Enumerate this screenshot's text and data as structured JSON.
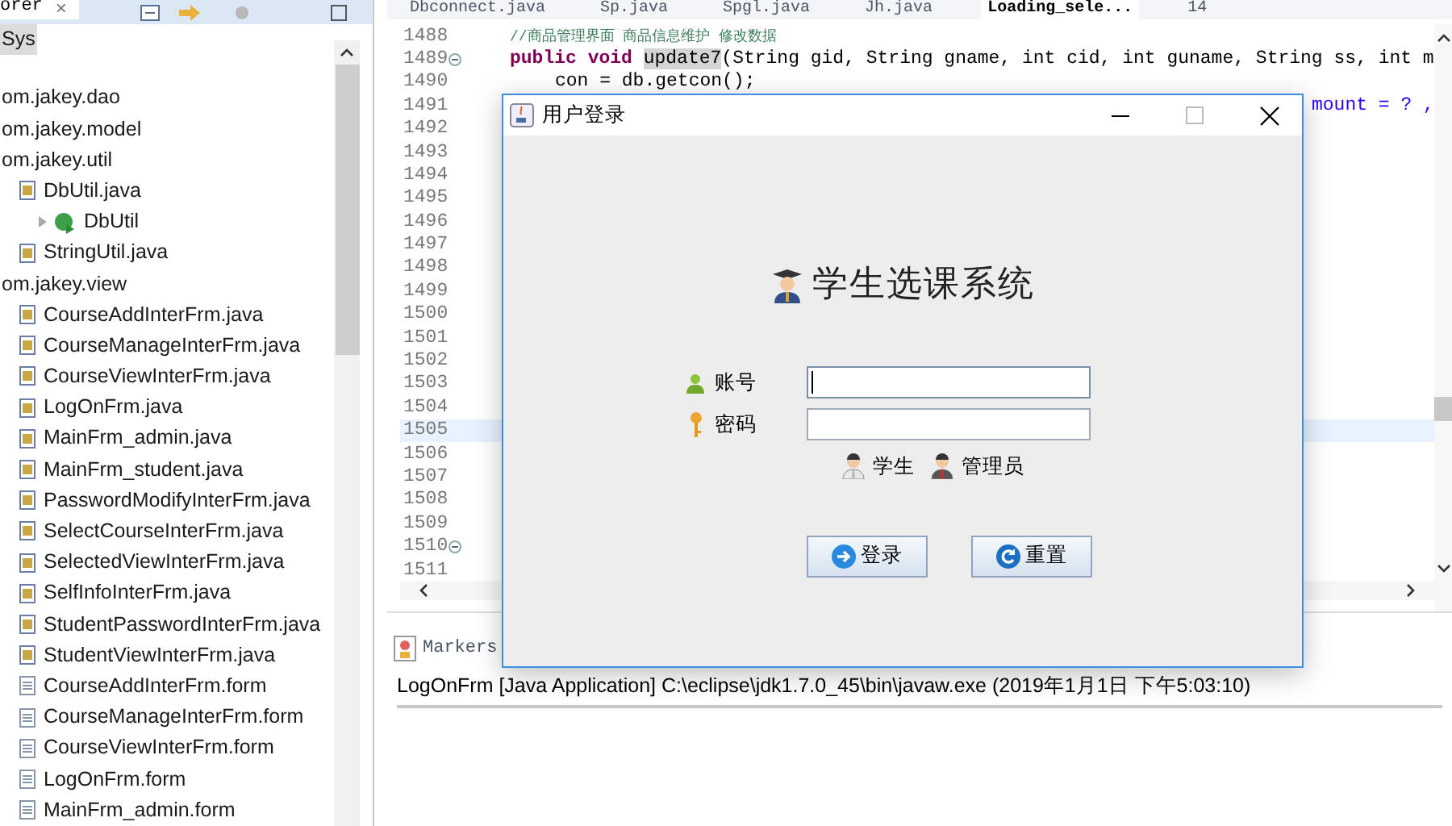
{
  "explorer": {
    "tab": {
      "title": "orer",
      "close": "×"
    },
    "tree": [
      {
        "label": "Sys",
        "kind": "project",
        "selected": true
      },
      {
        "label": "om.jakey.dao",
        "kind": "package",
        "selected": false
      },
      {
        "label": "om.jakey.model",
        "kind": "package",
        "selected": false
      },
      {
        "label": "om.jakey.util",
        "kind": "package",
        "selected": false,
        "children": [
          {
            "label": "DbUtil.java",
            "kind": "java",
            "selected": false,
            "children": [
              {
                "label": "DbUtil",
                "kind": "class",
                "selected": false
              }
            ]
          },
          {
            "label": "StringUtil.java",
            "kind": "java",
            "selected": false
          }
        ]
      },
      {
        "label": "om.jakey.view",
        "kind": "package",
        "selected": false,
        "children": [
          {
            "label": "CourseAddInterFrm.java",
            "kind": "java",
            "selected": false
          },
          {
            "label": "CourseManageInterFrm.java",
            "kind": "java",
            "selected": false
          },
          {
            "label": "CourseViewInterFrm.java",
            "kind": "java",
            "selected": false
          },
          {
            "label": "LogOnFrm.java",
            "kind": "java",
            "selected": false
          },
          {
            "label": "MainFrm_admin.java",
            "kind": "java",
            "selected": false
          },
          {
            "label": "MainFrm_student.java",
            "kind": "java",
            "selected": false
          },
          {
            "label": "PasswordModifyInterFrm.java",
            "kind": "java",
            "selected": false
          },
          {
            "label": "SelectCourseInterFrm.java",
            "kind": "java",
            "selected": false
          },
          {
            "label": "SelectedViewInterFrm.java",
            "kind": "java",
            "selected": false
          },
          {
            "label": "SelfInfoInterFrm.java",
            "kind": "java",
            "selected": false
          },
          {
            "label": "StudentPasswordInterFrm.java",
            "kind": "java",
            "selected": false
          },
          {
            "label": "StudentViewInterFrm.java",
            "kind": "java",
            "selected": false
          },
          {
            "label": "CourseAddInterFrm.form",
            "kind": "form",
            "selected": false
          },
          {
            "label": "CourseManageInterFrm.form",
            "kind": "form",
            "selected": false
          },
          {
            "label": "CourseViewInterFrm.form",
            "kind": "form",
            "selected": false
          },
          {
            "label": "LogOnFrm.form",
            "kind": "form",
            "selected": false
          },
          {
            "label": "MainFrm_admin.form",
            "kind": "form",
            "selected": false
          }
        ]
      }
    ]
  },
  "editor": {
    "tabs": [
      {
        "label": "Dbconnect.java",
        "selected": false
      },
      {
        "label": "Sp.java",
        "selected": false
      },
      {
        "label": "Spgl.java",
        "selected": false
      },
      {
        "label": "Jh.java",
        "selected": false
      },
      {
        "label": "Loading_sele...",
        "selected": true
      },
      {
        "label": "14",
        "selected": false
      }
    ],
    "lines": [
      {
        "number": "1488",
        "kind": "comment",
        "text": "//商品管理界面 商品信息维护 修改数据",
        "fold": false,
        "current": false
      },
      {
        "number": "1489",
        "kind": "signature",
        "text": "update7(String gid, String gname, int cid, int guname, String ss, int m",
        "fold": true,
        "current": false
      },
      {
        "number": "1490",
        "kind": "plain",
        "text": "con = db.getcon();",
        "fold": false,
        "current": false
      },
      {
        "number": "1491",
        "kind": "tail",
        "text": "mount = ? ,",
        "fold": false,
        "current": false
      },
      {
        "number": "1492",
        "kind": "plain",
        "fold": false,
        "current": false
      },
      {
        "number": "1493",
        "kind": "plain",
        "fold": false,
        "current": false
      },
      {
        "number": "1494",
        "kind": "plain",
        "fold": false,
        "current": false
      },
      {
        "number": "1495",
        "kind": "plain",
        "fold": false,
        "current": false
      },
      {
        "number": "1496",
        "kind": "plain",
        "fold": false,
        "current": false
      },
      {
        "number": "1497",
        "kind": "plain",
        "fold": false,
        "current": false
      },
      {
        "number": "1498",
        "kind": "plain",
        "fold": false,
        "current": false
      },
      {
        "number": "1499",
        "kind": "plain",
        "fold": false,
        "current": false
      },
      {
        "number": "1500",
        "kind": "plain",
        "fold": false,
        "current": false
      },
      {
        "number": "1501",
        "kind": "plain",
        "fold": false,
        "current": false
      },
      {
        "number": "1502",
        "kind": "plain",
        "fold": false,
        "current": false
      },
      {
        "number": "1503",
        "kind": "plain",
        "fold": false,
        "current": false
      },
      {
        "number": "1504",
        "kind": "plain",
        "fold": false,
        "current": false
      },
      {
        "number": "1505",
        "kind": "plain",
        "fold": false,
        "current": true
      },
      {
        "number": "1506",
        "kind": "plain",
        "fold": false,
        "current": false
      },
      {
        "number": "1507",
        "kind": "plain",
        "fold": false,
        "current": false
      },
      {
        "number": "1508",
        "kind": "plain",
        "fold": false,
        "current": false
      },
      {
        "number": "1509",
        "kind": "plain",
        "fold": false,
        "current": false
      },
      {
        "number": "1510",
        "kind": "plain",
        "fold": true,
        "current": false
      },
      {
        "number": "1511",
        "kind": "plain",
        "fold": false,
        "current": false
      }
    ],
    "keywords": [
      "public",
      "void"
    ]
  },
  "console": {
    "tab": "Markers",
    "status": "LogOnFrm [Java Application] C:\\eclipse\\jdk1.7.0_45\\bin\\javaw.exe (2019年1月1日 下午5:03:10)"
  },
  "dialog": {
    "title": "用户登录",
    "heading": "学生选课系统",
    "fields": [
      {
        "label": "账号",
        "kind": "user",
        "focused": true
      },
      {
        "label": "密码",
        "kind": "key",
        "focused": false
      }
    ],
    "roles": [
      {
        "label": "学生",
        "kind": "student"
      },
      {
        "label": "管理员",
        "kind": "admin"
      }
    ],
    "buttons": [
      {
        "label": "登录",
        "kind": "login"
      },
      {
        "label": "重置",
        "kind": "reset"
      }
    ]
  }
}
